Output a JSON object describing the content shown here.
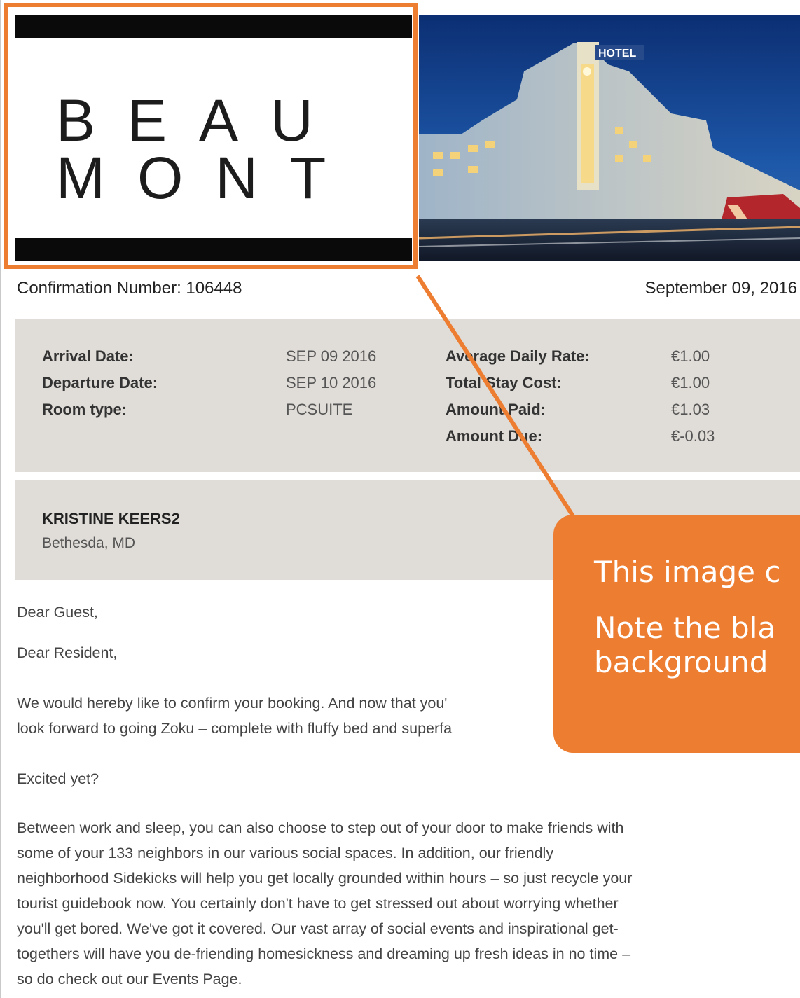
{
  "logo": {
    "line1": "BEAU",
    "line2": "MONT"
  },
  "photo": {
    "sign": "HOTEL"
  },
  "header": {
    "confirmation_number": "Confirmation Number: 106448",
    "date": "September 09, 2016"
  },
  "booking": {
    "arrival_label": "Arrival Date:",
    "arrival_value": "SEP 09 2016",
    "departure_label": "Departure Date:",
    "departure_value": "SEP 10 2016",
    "room_label": "Room type:",
    "room_value": "PCSUITE",
    "adr_label": "Average Daily Rate:",
    "adr_value": "€1.00",
    "total_label": "Total Stay Cost:",
    "total_value": "€1.00",
    "paid_label": "Amount Paid:",
    "paid_value": "€1.03",
    "due_label": "Amount Due:",
    "due_value": "€-0.03"
  },
  "guest": {
    "name": "KRISTINE KEERS2",
    "city": "Bethesda, MD"
  },
  "letter": {
    "greeting1": "Dear Guest,",
    "greeting2": "Dear Resident,",
    "para1_line1": "We would hereby like to confirm your booking. And now that you'",
    "para1_line2": "look forward to going Zoku – complete with fluffy bed and superfa",
    "excited": "Excited yet?",
    "para2": [
      "Between work and sleep, you can also choose to step out of your door to make friends with",
      "some of your 133 neighbors in our various social spaces. In addition, our friendly",
      "neighborhood Sidekicks will help you get locally grounded within hours – so just recycle your",
      "tourist guidebook now. You certainly don't have to get stressed out about worrying whether",
      "you'll get bored. We've got it covered. Our vast array of social events and inspirational get-",
      "togethers will have you de-friending homesickness and dreaming up fresh ideas in no time –",
      "so do check out our Events Page."
    ]
  },
  "annotation": {
    "line1": "This image c",
    "line2a": "Note the bla",
    "line2b": "background",
    "color": "#ed7d31"
  }
}
